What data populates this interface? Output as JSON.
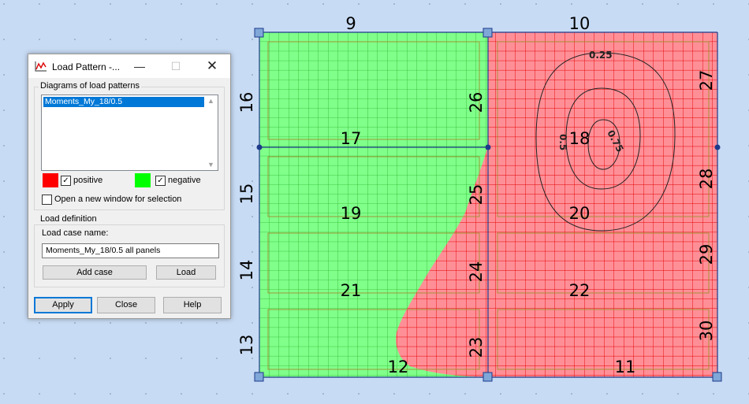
{
  "dialog": {
    "title": "Load Pattern -...",
    "diagrams_group_label": "Diagrams of load patterns",
    "list_items": [
      "Moments_My_18/0.5"
    ],
    "positive_label": "positive",
    "negative_label": "negative",
    "positive_checked": true,
    "negative_checked": true,
    "open_new_window_label": "Open a new window for selection",
    "open_new_window_checked": false,
    "load_definition_label": "Load definition",
    "load_case_name_label": "Load case name:",
    "load_case_name_value": "Moments_My_18/0.5 all panels",
    "add_case_button": "Add case",
    "load_button": "Load",
    "apply_button": "Apply",
    "close_button": "Close",
    "help_button": "Help"
  },
  "colors": {
    "positive": "#ff0000",
    "negative": "#00ff00",
    "positive_fill": "#ff8f97",
    "negative_fill": "#80ff8a",
    "background": "#c7dbf4"
  },
  "model": {
    "panels": [
      "17",
      "18",
      "19",
      "20",
      "21",
      "22"
    ],
    "edges": [
      "9",
      "10",
      "11",
      "12",
      "13",
      "14",
      "15",
      "16",
      "23",
      "24",
      "25",
      "26",
      "27",
      "28",
      "29",
      "30"
    ],
    "contours": [
      "0.25",
      "0.5",
      "0.75"
    ]
  }
}
